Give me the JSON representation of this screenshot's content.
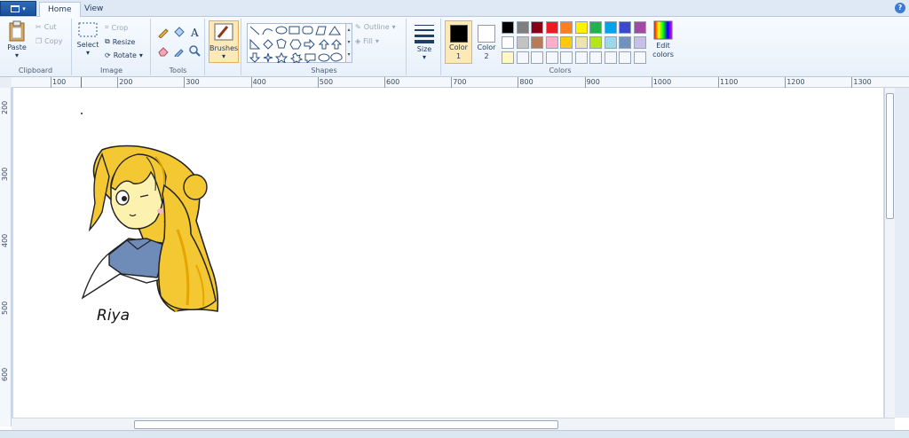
{
  "tabs": {
    "home": "Home",
    "view": "View"
  },
  "help_label": "?",
  "clipboard": {
    "paste": "Paste",
    "cut": "Cut",
    "copy": "Copy",
    "label": "Clipboard"
  },
  "image": {
    "select": "Select",
    "crop": "Crop",
    "resize": "Resize",
    "rotate": "Rotate",
    "label": "Image"
  },
  "tools": {
    "label": "Tools"
  },
  "brushes": {
    "label": "Brushes"
  },
  "shapes": {
    "outline": "Outline",
    "fill": "Fill",
    "label": "Shapes"
  },
  "size": {
    "label": "Size"
  },
  "colors": {
    "color1": "Color 1",
    "color2": "Color 2",
    "edit": "Edit colors",
    "label": "Colors",
    "color1_value": "#000000",
    "color2_value": "#ffffff",
    "row1": [
      "#000000",
      "#7f7f7f",
      "#880015",
      "#ed1c24",
      "#ff7f27",
      "#fff200",
      "#22b14c",
      "#00a2e8",
      "#3f48cc",
      "#a349a4"
    ],
    "row2": [
      "#ffffff",
      "#c3c3c3",
      "#b97a57",
      "#ffaec9",
      "#ffc90e",
      "#efe4b0",
      "#b5e61d",
      "#99d9ea",
      "#7092be",
      "#c8bfe7"
    ],
    "row3": [
      "#fff8c0",
      "#f4f7fb",
      "#f4f7fb",
      "#f4f7fb",
      "#f4f7fb",
      "#f4f7fb",
      "#f4f7fb",
      "#f4f7fb",
      "#f4f7fb",
      "#f4f7fb"
    ]
  },
  "ruler_h": [
    "100",
    "200",
    "300",
    "400",
    "500",
    "600",
    "700",
    "800",
    "900",
    "1000",
    "1100",
    "1200",
    "1300"
  ],
  "ruler_v": [
    "200",
    "300",
    "400",
    "500",
    "600"
  ],
  "drawing": {
    "signature": "Riya"
  }
}
